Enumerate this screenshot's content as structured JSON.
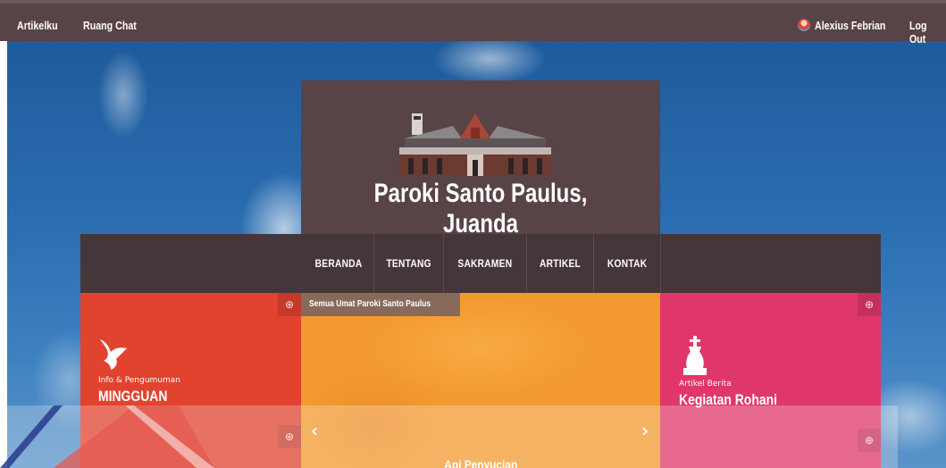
{
  "topbar": {
    "left_items": [
      "Artikelku",
      "Ruang Chat"
    ],
    "user_name": "Alexius Febrian",
    "logout_label": "Log Out"
  },
  "site": {
    "title": "Paroki Santo Paulus, Juanda"
  },
  "nav": {
    "items": [
      "BERANDA",
      "TENTANG",
      "SAKRAMEN",
      "ARTIKEL",
      "KONTAK"
    ]
  },
  "slider": {
    "caption": "Semua Umat Paroki Santo Paulus",
    "prev_label": "‹",
    "next_label": "›",
    "overlay_title": "Api Penyucian"
  },
  "tiles": {
    "left": {
      "subtitle": "Info & Pengumuman",
      "title": "MINGGUAN",
      "icon": "dove-icon"
    },
    "right": {
      "subtitle": "Artikel Berita",
      "title": "Kegiatan Rohani",
      "icon": "church-icon"
    }
  },
  "colors": {
    "topbar": "#584347",
    "navbar": "#45363a",
    "tile_red": "#e1432e",
    "tile_orange": "#f29a2f",
    "tile_pink": "#e0376a"
  }
}
